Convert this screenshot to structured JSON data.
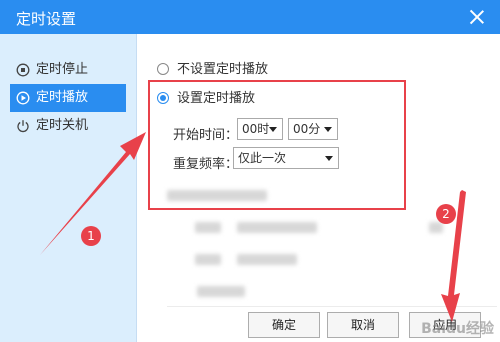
{
  "window": {
    "title": "定时设置"
  },
  "sidebar": {
    "items": [
      {
        "label": "定时停止",
        "icon": "stop-clock-icon"
      },
      {
        "label": "定时播放",
        "icon": "play-clock-icon"
      },
      {
        "label": "定时关机",
        "icon": "power-icon"
      }
    ],
    "active_index": 1
  },
  "main": {
    "option_off": "不设置定时播放",
    "option_on": "设置定时播放",
    "selected_option": "设置定时播放",
    "start_time_label": "开始时间：",
    "hour_value": "00时",
    "minute_value": "00分",
    "repeat_label": "重复频率：",
    "repeat_value": "仅此一次"
  },
  "buttons": {
    "ok": "确定",
    "cancel": "取消",
    "apply": "应用"
  },
  "annotations": {
    "badge1": "1",
    "badge2": "2"
  },
  "watermark": "Baidu经验",
  "colors": {
    "accent": "#2a8df0",
    "highlight": "#e8414a",
    "sidebar_bg": "#dbeefd"
  }
}
